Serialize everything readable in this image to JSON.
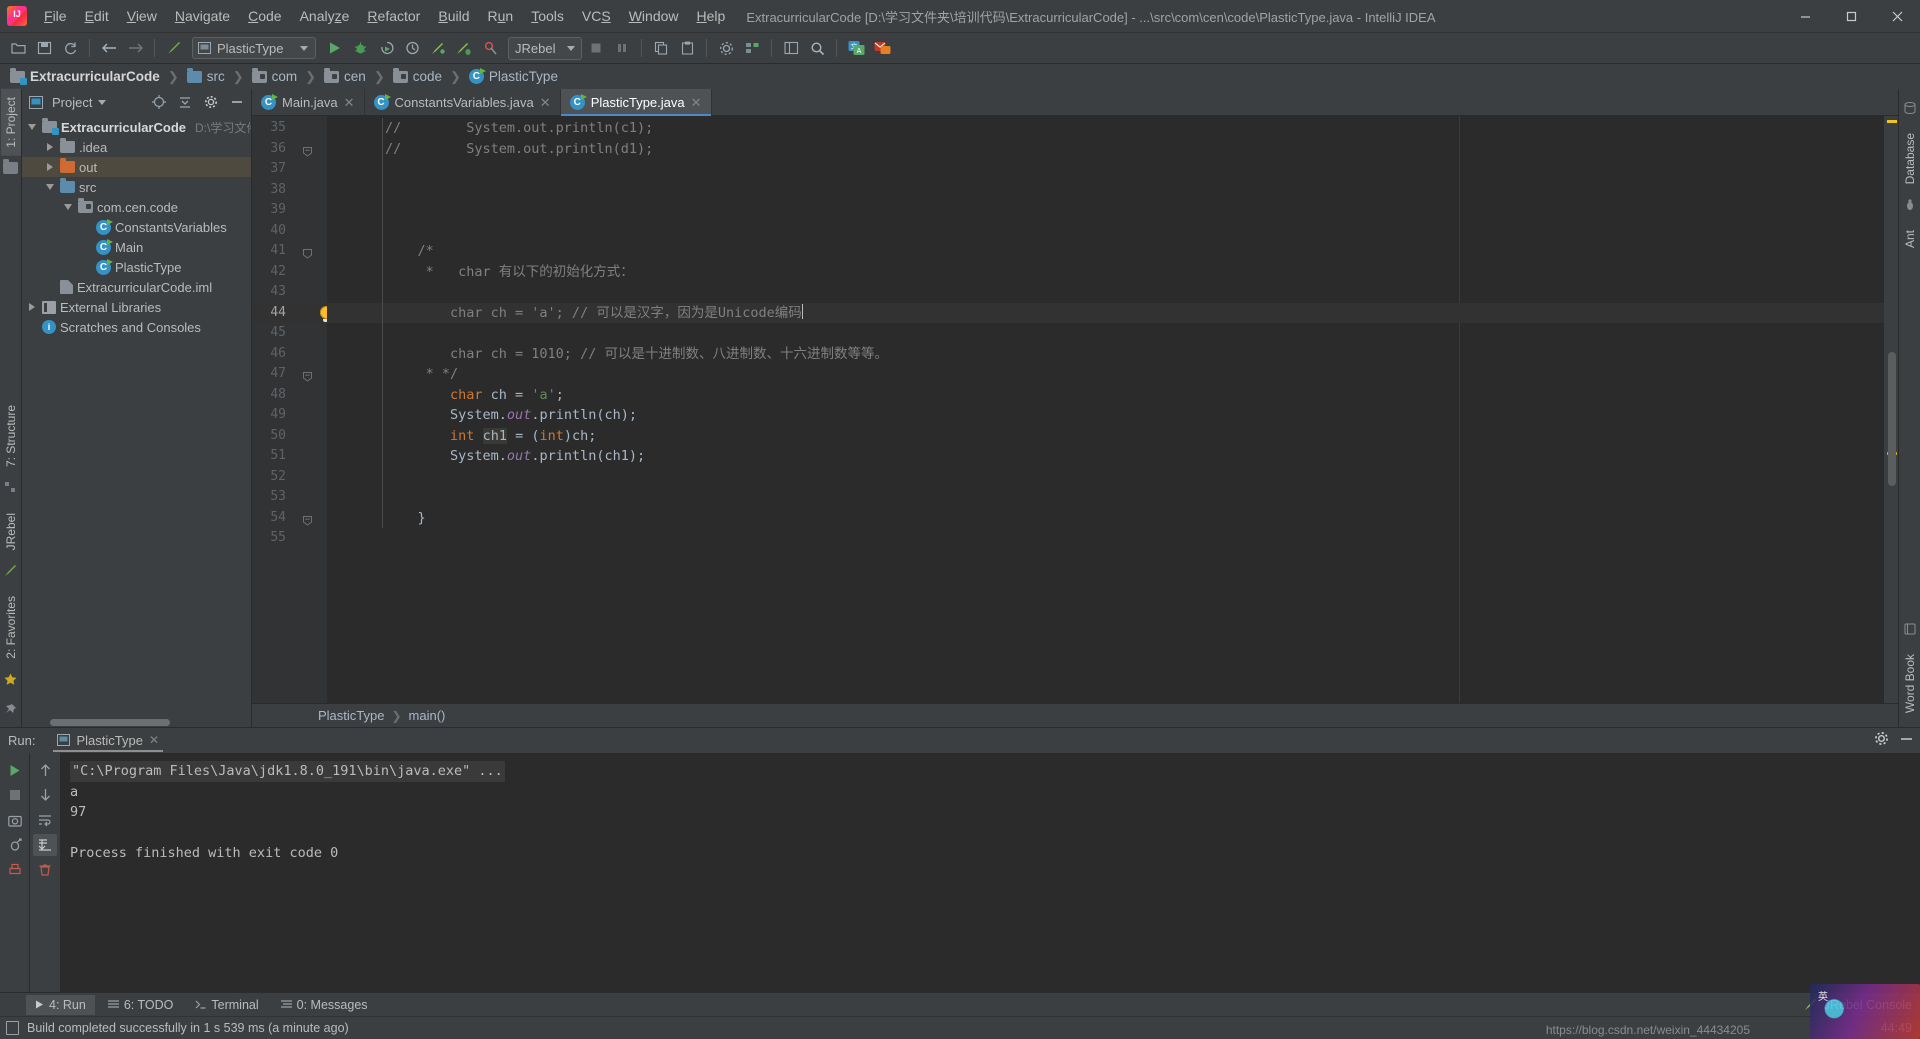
{
  "window": {
    "title": "ExtracurricularCode [D:\\学习文件夹\\培训代码\\ExtracurricularCode] - ...\\src\\com\\cen\\code\\PlasticType.java - IntelliJ IDEA",
    "minimize": "—",
    "maximize": "▢",
    "close": "✕"
  },
  "menu": [
    {
      "label": "File"
    },
    {
      "label": "Edit"
    },
    {
      "label": "View"
    },
    {
      "label": "Navigate"
    },
    {
      "label": "Code"
    },
    {
      "label": "Analyze"
    },
    {
      "label": "Refactor"
    },
    {
      "label": "Build"
    },
    {
      "label": "Run"
    },
    {
      "label": "Tools"
    },
    {
      "label": "VCS"
    },
    {
      "label": "Window"
    },
    {
      "label": "Help"
    }
  ],
  "toolbar": {
    "run_config": "PlasticType",
    "jrebel": "JRebel",
    "icons": [
      "open-folder-icon",
      "save-icon",
      "sync-icon",
      "back-arrow-icon",
      "forward-arrow-icon",
      "build-hammer-icon",
      "run-icon",
      "debug-icon",
      "run-coverage-icon",
      "profiler-icon",
      "jrebel-run-icon",
      "jrebel-debug-icon",
      "jrebel-stop-icon",
      "stop-icon",
      "pause-icon",
      "copy-icon",
      "paste-icon",
      "settings-icon",
      "structure-icon",
      "project-structure-icon",
      "search-everywhere-icon",
      "translate-icon",
      "mail-icon"
    ]
  },
  "breadcrumb": [
    {
      "label": "ExtracurricularCode",
      "icon": "module-folder-icon"
    },
    {
      "label": "src",
      "icon": "source-folder-icon"
    },
    {
      "label": "com",
      "icon": "package-icon"
    },
    {
      "label": "cen",
      "icon": "package-icon"
    },
    {
      "label": "code",
      "icon": "package-icon"
    },
    {
      "label": "PlasticType",
      "icon": "java-class-icon"
    }
  ],
  "left_strip": {
    "project_tab": "1: Project",
    "structure_tab": "7: Structure",
    "jrebel_tab": "JRebel",
    "favorites_tab": "2: Favorites"
  },
  "right_strip": {
    "database_tab": "Database",
    "ant_tab": "Ant",
    "word_book_tab": "Word Book"
  },
  "project_panel": {
    "title": "Project",
    "tree": [
      {
        "label": "ExtracurricularCode",
        "sub": "D:\\学习文件夹",
        "depth": 0,
        "twisty": "down",
        "icon": "project-folder-icon",
        "bold": true,
        "selected": false
      },
      {
        "label": ".idea",
        "sub": "",
        "depth": 1,
        "twisty": "right",
        "icon": "folder-gray-icon",
        "bold": false,
        "selected": false
      },
      {
        "label": "out",
        "sub": "",
        "depth": 1,
        "twisty": "right",
        "icon": "folder-orange-icon",
        "bold": false,
        "selected": true
      },
      {
        "label": "src",
        "sub": "",
        "depth": 1,
        "twisty": "down",
        "icon": "folder-blue-icon",
        "bold": false,
        "selected": false
      },
      {
        "label": "com.cen.code",
        "sub": "",
        "depth": 2,
        "twisty": "down",
        "icon": "package-icon",
        "bold": false,
        "selected": false
      },
      {
        "label": "ConstantsVariables",
        "sub": "",
        "depth": 3,
        "twisty": "none",
        "icon": "java-class-icon",
        "bold": false,
        "selected": false
      },
      {
        "label": "Main",
        "sub": "",
        "depth": 3,
        "twisty": "none",
        "icon": "java-class-icon",
        "bold": false,
        "selected": false
      },
      {
        "label": "PlasticType",
        "sub": "",
        "depth": 3,
        "twisty": "none",
        "icon": "java-class-icon",
        "bold": false,
        "selected": false
      },
      {
        "label": "ExtracurricularCode.iml",
        "sub": "",
        "depth": 1,
        "twisty": "none",
        "icon": "iml-file-icon",
        "bold": false,
        "selected": false
      },
      {
        "label": "External Libraries",
        "sub": "",
        "depth": 0,
        "twisty": "right",
        "icon": "library-icon",
        "bold": false,
        "selected": false
      },
      {
        "label": "Scratches and Consoles",
        "sub": "",
        "depth": 0,
        "twisty": "none",
        "icon": "scratches-icon",
        "bold": false,
        "selected": false
      }
    ]
  },
  "editor": {
    "tabs": [
      {
        "label": "Main.java",
        "active": false
      },
      {
        "label": "ConstantsVariables.java",
        "active": false
      },
      {
        "label": "PlasticType.java",
        "active": true
      }
    ],
    "first_line": 35,
    "current_line": 44,
    "lines": [
      {
        "n": 35,
        "fold": "",
        "tokens": [
          {
            "t": "cmt",
            "s": "//        System.out.println(c1);"
          }
        ]
      },
      {
        "n": 36,
        "fold": "minus",
        "tokens": [
          {
            "t": "cmt",
            "s": "//        System.out.println(d1);"
          }
        ]
      },
      {
        "n": 37,
        "fold": "",
        "tokens": []
      },
      {
        "n": 38,
        "fold": "",
        "tokens": []
      },
      {
        "n": 39,
        "fold": "",
        "tokens": []
      },
      {
        "n": 40,
        "fold": "",
        "tokens": []
      },
      {
        "n": 41,
        "fold": "arrow",
        "tokens": [
          {
            "t": "cmt",
            "s": "    /*"
          }
        ]
      },
      {
        "n": 42,
        "fold": "",
        "tokens": [
          {
            "t": "cmt",
            "s": "     *   char 有以下的初始化方式："
          }
        ]
      },
      {
        "n": 43,
        "fold": "",
        "tokens": []
      },
      {
        "n": 44,
        "fold": "",
        "tokens": [
          {
            "t": "cmt",
            "s": "        char ch = 'a'; // 可以是汉字，因为是Unicode编码"
          }
        ]
      },
      {
        "n": 45,
        "fold": "",
        "tokens": []
      },
      {
        "n": 46,
        "fold": "",
        "tokens": [
          {
            "t": "cmt",
            "s": "        char ch = 1010; // 可以是十进制数、八进制数、十六进制数等等。"
          }
        ]
      },
      {
        "n": 47,
        "fold": "minus",
        "tokens": [
          {
            "t": "cmt",
            "s": "     * */"
          }
        ]
      },
      {
        "n": 48,
        "fold": "",
        "tokens": [
          {
            "t": "plain",
            "s": "        "
          },
          {
            "t": "kw",
            "s": "char"
          },
          {
            "t": "plain",
            "s": " ch = "
          },
          {
            "t": "str",
            "s": "'a'"
          },
          {
            "t": "plain",
            "s": ";"
          }
        ]
      },
      {
        "n": 49,
        "fold": "",
        "tokens": [
          {
            "t": "plain",
            "s": "        System."
          },
          {
            "t": "fld",
            "s": "out"
          },
          {
            "t": "plain",
            "s": ".println(ch);"
          }
        ]
      },
      {
        "n": 50,
        "fold": "",
        "tokens": [
          {
            "t": "plain",
            "s": "        "
          },
          {
            "t": "kw",
            "s": "int"
          },
          {
            "t": "plain",
            "s": " "
          },
          {
            "t": "hl",
            "s": "ch1"
          },
          {
            "t": "plain",
            "s": " = ("
          },
          {
            "t": "kw",
            "s": "int"
          },
          {
            "t": "plain",
            "s": ")ch;"
          }
        ]
      },
      {
        "n": 51,
        "fold": "",
        "tokens": [
          {
            "t": "plain",
            "s": "        System."
          },
          {
            "t": "fld",
            "s": "out"
          },
          {
            "t": "plain",
            "s": ".println(ch1);"
          }
        ]
      },
      {
        "n": 52,
        "fold": "",
        "tokens": []
      },
      {
        "n": 53,
        "fold": "",
        "tokens": []
      },
      {
        "n": 54,
        "fold": "minus",
        "tokens": [
          {
            "t": "plain",
            "s": "    }"
          }
        ]
      },
      {
        "n": 55,
        "fold": "",
        "tokens": []
      }
    ],
    "breadcrumb": [
      "PlasticType",
      "main()"
    ]
  },
  "run_panel": {
    "label": "Run:",
    "tab": "PlasticType",
    "close": "✕",
    "console": [
      {
        "text": "\"C:\\Program Files\\Java\\jdk1.8.0_191\\bin\\java.exe\" ...",
        "style": "cmd"
      },
      {
        "text": "a",
        "style": "plain"
      },
      {
        "text": "97",
        "style": "plain"
      },
      {
        "text": "",
        "style": "plain"
      },
      {
        "text": "Process finished with exit code 0",
        "style": "plain"
      }
    ],
    "left_buttons": [
      "rerun-icon",
      "stop-icon",
      "screenshot-icon",
      "dump-threads-icon",
      "print-icon"
    ],
    "right_buttons": [
      "scroll-up-icon",
      "scroll-down-icon",
      "soft-wrap-icon",
      "scroll-to-end-icon",
      "clear-all-icon"
    ],
    "header_buttons": [
      "settings-gear-icon",
      "hide-icon"
    ]
  },
  "tool_tabs": [
    {
      "label": "4: Run",
      "icon": "run-triangle-icon",
      "active": true
    },
    {
      "label": "6: TODO",
      "icon": "todo-icon",
      "active": false
    },
    {
      "label": "Terminal",
      "icon": "terminal-icon",
      "active": false
    },
    {
      "label": "0: Messages",
      "icon": "messages-icon",
      "active": false
    }
  ],
  "tool_tabs_right": {
    "jrebel_console": "JRebel Console"
  },
  "statusbar": {
    "message": "Build completed successfully in 1 s 539 ms (a minute ago)",
    "caret_position": "44:49",
    "watermark_url": "https://blog.csdn.net/weixin_44434205"
  },
  "colors": {
    "accent": "#4a88c7",
    "editor_bg": "#2b2b2b",
    "panel_bg": "#3c3f41",
    "keyword": "#cc7832",
    "string": "#6a8759",
    "number": "#6897bb",
    "comment": "#808080",
    "field": "#9876aa",
    "selection": "#4e4a3f"
  }
}
